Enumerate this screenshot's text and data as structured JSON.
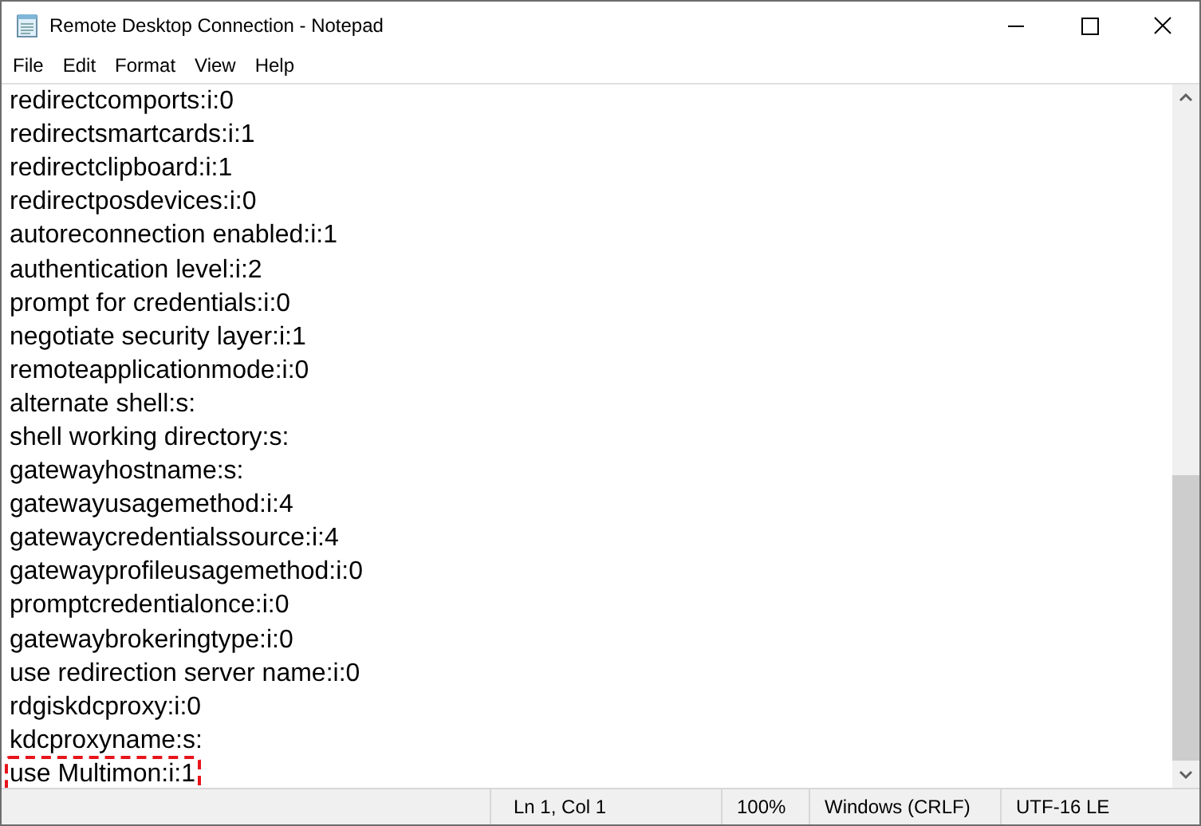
{
  "window": {
    "title": "Remote Desktop Connection - Notepad"
  },
  "menu": [
    "File",
    "Edit",
    "Format",
    "View",
    "Help"
  ],
  "lines": [
    {
      "text": "redirectcomports:i:0",
      "highlighted": false
    },
    {
      "text": "redirectsmartcards:i:1",
      "highlighted": false
    },
    {
      "text": "redirectclipboard:i:1",
      "highlighted": false
    },
    {
      "text": "redirectposdevices:i:0",
      "highlighted": false
    },
    {
      "text": "autoreconnection enabled:i:1",
      "highlighted": false
    },
    {
      "text": "authentication level:i:2",
      "highlighted": false
    },
    {
      "text": "prompt for credentials:i:0",
      "highlighted": false
    },
    {
      "text": "negotiate security layer:i:1",
      "highlighted": false
    },
    {
      "text": "remoteapplicationmode:i:0",
      "highlighted": false
    },
    {
      "text": "alternate shell:s:",
      "highlighted": false
    },
    {
      "text": "shell working directory:s:",
      "highlighted": false
    },
    {
      "text": "gatewayhostname:s:",
      "highlighted": false
    },
    {
      "text": "gatewayusagemethod:i:4",
      "highlighted": false
    },
    {
      "text": "gatewaycredentialssource:i:4",
      "highlighted": false
    },
    {
      "text": "gatewayprofileusagemethod:i:0",
      "highlighted": false
    },
    {
      "text": "promptcredentialonce:i:0",
      "highlighted": false
    },
    {
      "text": "gatewaybrokeringtype:i:0",
      "highlighted": false
    },
    {
      "text": "use redirection server name:i:0",
      "highlighted": false
    },
    {
      "text": "rdgiskdcproxy:i:0",
      "highlighted": false
    },
    {
      "text": "kdcproxyname:s:",
      "highlighted": false
    },
    {
      "text": "use Multimon:i:1",
      "highlighted": true
    }
  ],
  "status_bar": [
    "Ln 1, Col 1",
    "100%",
    "Windows (CRLF)",
    "UTF-16 LE"
  ]
}
